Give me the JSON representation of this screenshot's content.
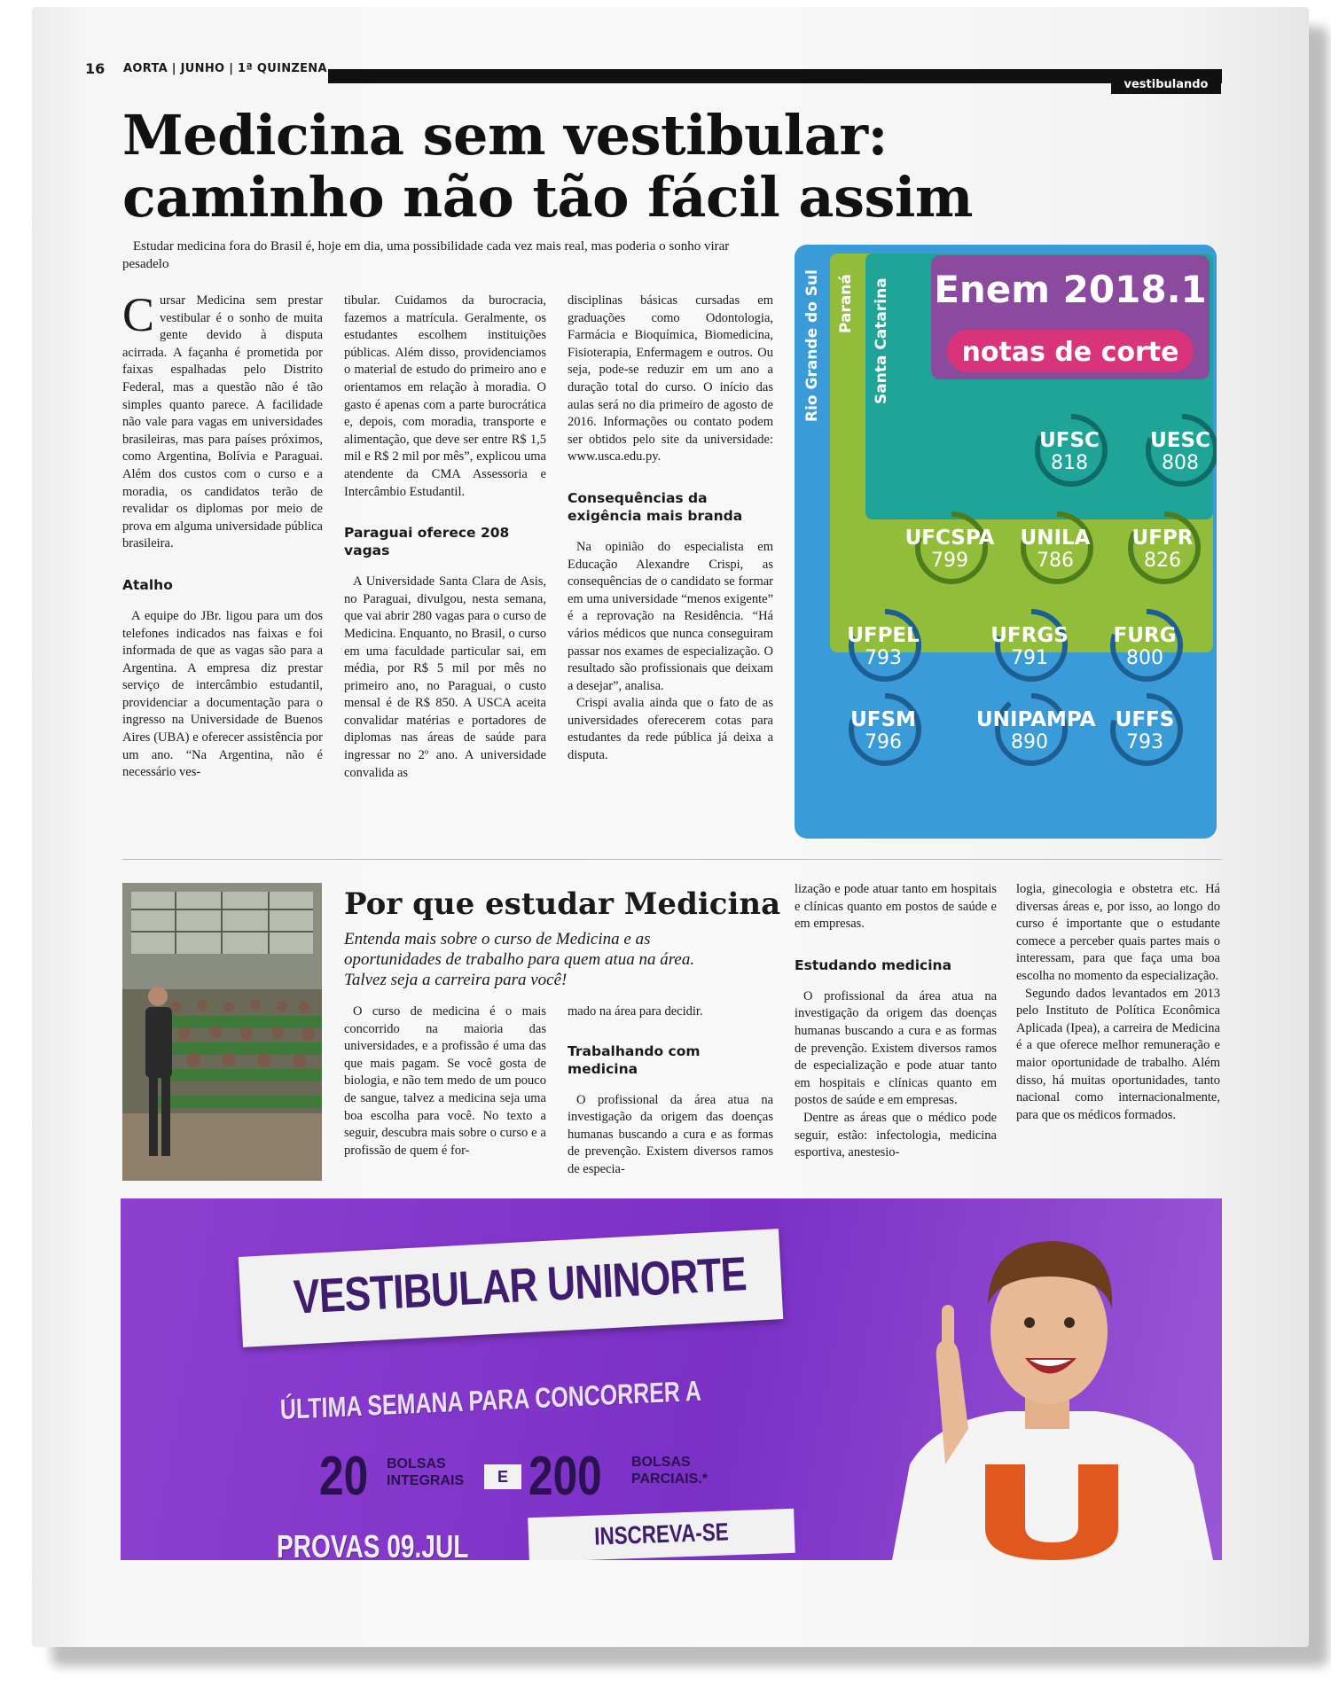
{
  "header": {
    "page_number": "16",
    "publication_line": "AORTA | JUNHO | 1ª QUINZENA",
    "section": "vestibulando"
  },
  "article1": {
    "headline": "Medicina sem vestibular: caminho não tão fácil assim",
    "lead": "Estudar medicina fora do Brasil é, hoje em dia, uma possibilidade cada vez mais real, mas poderia o sonho virar pesadelo",
    "col1": {
      "dropcap": "C",
      "p1": "ursar Medicina sem prestar vestibular é o sonho de muita gente devido à disputa acirrada. A façanha é prometida por faixas espalhadas pelo Distrito Federal, mas a questão não é tão simples quanto parece. A facilidade não vale para vagas em universidades brasileiras, mas para países próximos, como Argentina, Bolívia e Paraguai. Além dos custos com o curso e a moradia, os candidatos terão de revalidar os diplomas por meio de prova em alguma universidade pública brasileira.",
      "subhead": "Atalho",
      "p2": "A equipe do JBr. ligou para um dos telefones indicados nas faixas e foi informada de que as vagas são para a Argentina. A empresa diz prestar serviço de intercâmbio estudantil, providenciar a documentação para o ingresso na Universidade de Buenos Aires (UBA) e oferecer assistência por um ano. “Na Argentina, não é necessário ves-"
    },
    "col2": {
      "p1": "tibular. Cuidamos da burocracia, fazemos a matrícula. Geralmente, os estudantes escolhem instituições públicas. Além disso, providenciamos o material de estudo do primeiro ano e orientamos em relação à moradia. O gasto é apenas com a parte burocrática e, depois, com moradia, transporte e alimentação, que deve ser entre R$ 1,5 mil e R$ 2 mil por mês”, explicou uma atendente da CMA Assessoria e Intercâmbio Estudantil.",
      "subhead": "Paraguai oferece 208 vagas",
      "p2": "A Universidade Santa Clara de Asis, no Paraguai, divulgou, nesta semana, que vai abrir 280 vagas para o curso de Medicina. Enquanto, no Brasil, o curso em uma faculdade particular sai, em média, por R$ 5 mil por mês no primeiro ano, no Paraguai, o custo mensal é de R$ 850. A USCA aceita convalidar matérias e portadores de diplomas nas áreas de saúde para ingressar no 2º ano. A universidade convalida as"
    },
    "col3": {
      "p1": "disciplinas básicas cursadas em graduações como Odontologia, Farmácia e Bioquímica, Biomedicina, Fisioterapia, Enfermagem e outros. Ou seja, pode-se reduzir em um ano a duração total do curso. O início das aulas será no dia primeiro de agosto de 2016. Informações ou contato podem ser obtidos pelo site da universidade: www.usca.edu.py.",
      "subhead": "Consequências da exigência mais branda",
      "p2": "Na opinião do especialista em Educação Alexandre Crispi, as consequências de o candidato se formar em uma universidade “menos exigente” é a reprovação na Residência. “Há vários médicos que nunca conseguiram passar nos exames de especialização. O resultado são profissionais que deixam a desejar”, analisa.",
      "p3": "Crispi avalia ainda que o fato de as universidades oferecerem cotas para estudantes da rede pública já deixa a disputa."
    }
  },
  "infographic": {
    "title": "Enem 2018.1",
    "subtitle": "notas de corte",
    "regions": [
      "Rio Grande do Sul",
      "Paraná",
      "Santa Catarina"
    ],
    "colors": {
      "rs": "#3a9bd9",
      "pr": "#92bd3a",
      "sc": "#1fa498",
      "title_bg": "#8c4a9e",
      "pill": "#d8337b"
    },
    "max_score": 1000,
    "universities": [
      {
        "name": "UFSC",
        "score": "818",
        "value": 818,
        "region": "Santa Catarina"
      },
      {
        "name": "UESC",
        "score": "808",
        "value": 808,
        "region": "Santa Catarina"
      },
      {
        "name": "UFCSPA",
        "score": "799",
        "value": 799,
        "region": "Paraná"
      },
      {
        "name": "UNILA",
        "score": "786",
        "value": 786,
        "region": "Paraná"
      },
      {
        "name": "UFPR",
        "score": "826",
        "value": 826,
        "region": "Paraná"
      },
      {
        "name": "UFPEL",
        "score": "793",
        "value": 793,
        "region": "Rio Grande do Sul"
      },
      {
        "name": "UFRGS",
        "score": "791",
        "value": 791,
        "region": "Rio Grande do Sul"
      },
      {
        "name": "FURG",
        "score": "800",
        "value": 800,
        "region": "Rio Grande do Sul"
      },
      {
        "name": "UFSM",
        "score": "796",
        "value": 796,
        "region": "Rio Grande do Sul"
      },
      {
        "name": "UNIPAMPA",
        "score": "890",
        "value": 890,
        "region": "Rio Grande do Sul"
      },
      {
        "name": "UFFS",
        "score": "793",
        "value": 793,
        "region": "Rio Grande do Sul"
      }
    ]
  },
  "article2": {
    "title": "Por que estudar Medicina",
    "deck": "Entenda mais sobre o curso de Medicina e as oportunidades de trabalho para quem atua na área. Talvez seja a carreira para você!",
    "col1": "O curso de medicina é o mais concorrido na maioria das universidades, e a profissão é uma das que mais pagam. Se você gosta de biologia, e não tem medo de um pouco de sangue, talvez a medicina seja uma boa escolha para você. No texto a seguir, descubra mais sobre o curso e a profissão de quem é for-",
    "col2": {
      "p1": "mado na área para decidir.",
      "subhead": "Trabalhando com medicina",
      "p2": "O profissional da área atua na investigação da origem das doenças humanas buscando a cura e as formas de prevenção. Existem diversos ramos de especia-"
    },
    "col3": {
      "p1": "lização e pode atuar tanto em hospitais e clínicas quanto em postos de saúde e em empresas.",
      "subhead": "Estudando medicina",
      "p2": "O profissional da área atua na investigação da origem das doenças humanas buscando a cura e as formas de prevenção. Existem diversos ramos de especialização e pode atuar tanto em hospitais e clínicas quanto em postos de saúde e em empresas.",
      "p3": "Dentre as áreas que o médico pode seguir, estão: infectologia, medicina esportiva, anestesio-"
    },
    "col4": {
      "p1": "logia, ginecologia e obstetra etc. Há diversas áreas e, por isso, ao longo do curso é importante que o estudante comece a perceber quais partes mais o interessam, para que faça uma boa escolha no momento da especialização.",
      "p2": "Segundo dados levantados em 2013 pelo Instituto de Política Econômica Aplicada (Ipea), a carreira de Medicina é a que oferece melhor remuneração e maior oportunidade de trabalho. Além disso, há muitas oportunidades, tanto nacional como internacionalmente, para que os médicos formados."
    }
  },
  "ad": {
    "title": "VESTIBULAR UNINORTE",
    "subtitle": "ÚLTIMA SEMANA PARA CONCORRER A",
    "num1": "20",
    "num1_label_a": "BOLSAS",
    "num1_label_b": "INTEGRAIS",
    "conj": "E",
    "num2": "200",
    "num2_label_a": "BOLSAS",
    "num2_label_b": "PARCIAIS.*",
    "exam": "PROVAS 09.JUL",
    "cta": "INSCREVA-SE",
    "shirt_letter": "U"
  }
}
